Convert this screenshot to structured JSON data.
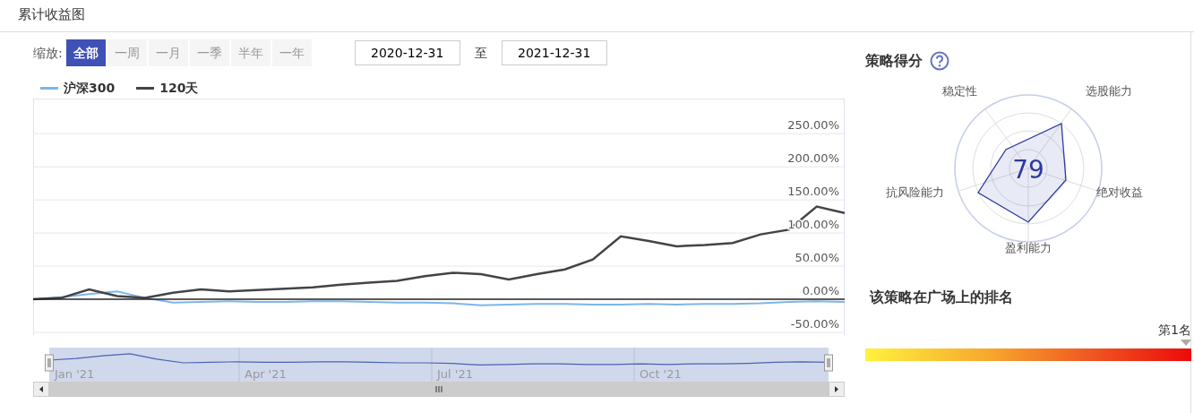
{
  "header": {
    "title": "累计收益图"
  },
  "zoom": {
    "label": "缩放:",
    "buttons": [
      {
        "label": "全部",
        "selected": true
      },
      {
        "label": "一周",
        "selected": false
      },
      {
        "label": "一月",
        "selected": false
      },
      {
        "label": "一季",
        "selected": false
      },
      {
        "label": "半年",
        "selected": false
      },
      {
        "label": "一年",
        "selected": false
      }
    ]
  },
  "date_range": {
    "from": "2020-12-31",
    "separator": "至",
    "to": "2021-12-31"
  },
  "chart_data": {
    "type": "line",
    "grid": true,
    "ylim": [
      -54,
      303
    ],
    "yticks": [
      {
        "value": -50,
        "label": "-50.00%"
      },
      {
        "value": 0,
        "label": "0.00%"
      },
      {
        "value": 50,
        "label": "50.00%"
      },
      {
        "value": 100,
        "label": "100.00%"
      },
      {
        "value": 150,
        "label": "150.00%"
      },
      {
        "value": 200,
        "label": "200.00%"
      },
      {
        "value": 250,
        "label": "250.00%"
      }
    ],
    "series": [
      {
        "name": "沪深300",
        "color": "#7cb5ec",
        "values": [
          0,
          3,
          8,
          12,
          2,
          -5,
          -4,
          -3,
          -4,
          -4,
          -3,
          -3,
          -4,
          -5,
          -5,
          -6,
          -9,
          -8,
          -7,
          -7,
          -8,
          -8,
          -7,
          -8,
          -7,
          -7,
          -6,
          -4,
          -3,
          -4
        ]
      },
      {
        "name": "120天",
        "color": "#434348",
        "values": [
          0,
          2,
          15,
          5,
          2,
          10,
          15,
          12,
          14,
          16,
          18,
          22,
          25,
          28,
          35,
          40,
          38,
          30,
          38,
          45,
          60,
          95,
          88,
          80,
          82,
          85,
          98,
          105,
          140,
          130
        ]
      }
    ]
  },
  "navigator": {
    "labels": [
      "Jan '21",
      "Apr '21",
      "Jul '21",
      "Oct '21"
    ]
  },
  "score": {
    "title": "策略得分",
    "value": "79",
    "axes": [
      "选股能力",
      "绝对收益",
      "盈利能力",
      "抗风险能力",
      "稳定性"
    ]
  },
  "ranking": {
    "title": "该策略在广场上的排名",
    "rank": "第1名"
  }
}
